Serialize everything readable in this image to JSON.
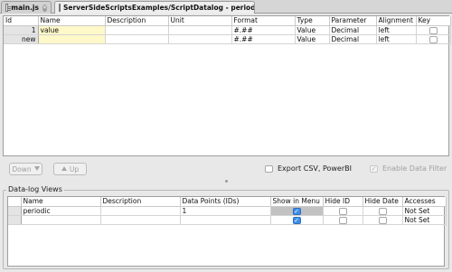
{
  "tabs": [
    {
      "label": "main.js",
      "icon": "document-icon"
    },
    {
      "label": "ServerSideScriptsExamples/ScriptDatalog - periodic",
      "icon": "table-icon"
    }
  ],
  "fields_table": {
    "columns": [
      "Id",
      "Name",
      "Description",
      "Unit",
      "Format",
      "Type",
      "Parameter",
      "Alignment",
      "Key"
    ],
    "rows": [
      {
        "id": "1",
        "name": "value",
        "description": "",
        "unit": "",
        "format": "#.##",
        "type": "Value",
        "parameter": "Decimal",
        "alignment": "left",
        "key": false
      },
      {
        "id": "new",
        "name": "",
        "description": "",
        "unit": "",
        "format": "#.##",
        "type": "Value",
        "parameter": "Decimal",
        "alignment": "left",
        "key": false
      }
    ]
  },
  "toolbar": {
    "down_label": "Down",
    "up_label": "Up",
    "export_label": "Export CSV, PowerBI",
    "export_checked": false,
    "enable_filter_label": "Enable Data Filter",
    "enable_filter_checked": true
  },
  "datalog_views": {
    "title": "Data-log Views",
    "columns": [
      "Name",
      "Description",
      "Data Points (IDs)",
      "Show in Menu",
      "Hide ID",
      "Hide Date",
      "Accesses"
    ],
    "rows": [
      {
        "name": "periodic",
        "description": "",
        "data_points": "1",
        "show_in_menu": true,
        "hide_id": false,
        "hide_date": false,
        "accesses": "Not Set"
      },
      {
        "name": "",
        "description": "",
        "data_points": "",
        "show_in_menu": true,
        "hide_id": false,
        "hide_date": false,
        "accesses": "Not Set"
      }
    ]
  },
  "colors": {
    "checkbox_checked": "#3d8ee8",
    "name_cell_highlight": "#fff8c8",
    "selected_cell": "#c2c2c2"
  }
}
